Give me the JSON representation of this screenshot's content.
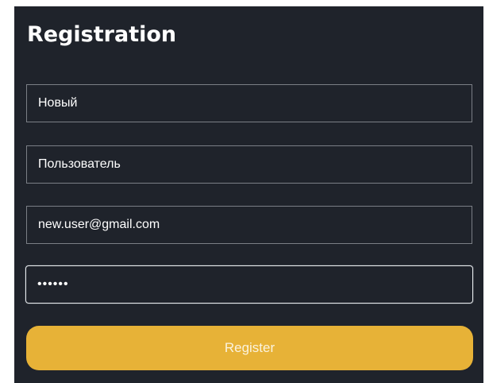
{
  "form": {
    "title": "Registration",
    "first_name": "Новый",
    "last_name": "Пользователь",
    "email": "new.user@gmail.com",
    "password": "••••••",
    "register_label": "Register"
  },
  "colors": {
    "background": "#1f232b",
    "accent": "#e7b237",
    "text": "#ffffff",
    "border": "#7b7f86"
  }
}
